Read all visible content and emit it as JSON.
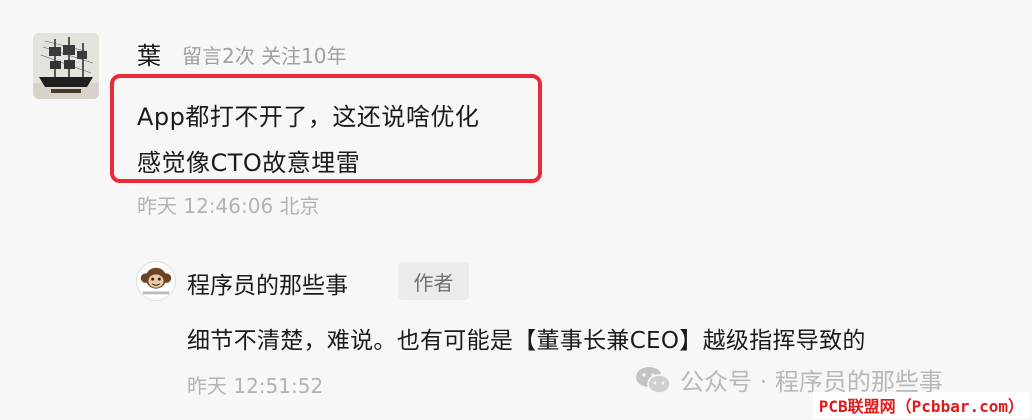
{
  "comment": {
    "username": "葉",
    "meta": "留言2次 关注10年",
    "text_line1": "App都打不开了，这还说啥优化",
    "text_line2": "感觉像CTO故意埋雷",
    "time": "昨天 12:46:06 北京"
  },
  "reply": {
    "author_name": "程序员的那些事",
    "author_tag": "作者",
    "text": "细节不清楚，难说。也有可能是【董事长兼CEO】越级指挥导致的",
    "time": "昨天 12:51:52"
  },
  "watermark": {
    "text": "公众号 · 程序员的那些事",
    "site": "PCB联盟网（Pcbbar.com）"
  },
  "colors": {
    "highlight_border": "#ec2a37",
    "meta_gray": "#a0a0a0",
    "site_red": "#e01b1b"
  },
  "icons": {
    "comment_avatar": "ship-photo-avatar",
    "reply_avatar": "monkey-avatar",
    "watermark": "wechat-icon"
  }
}
